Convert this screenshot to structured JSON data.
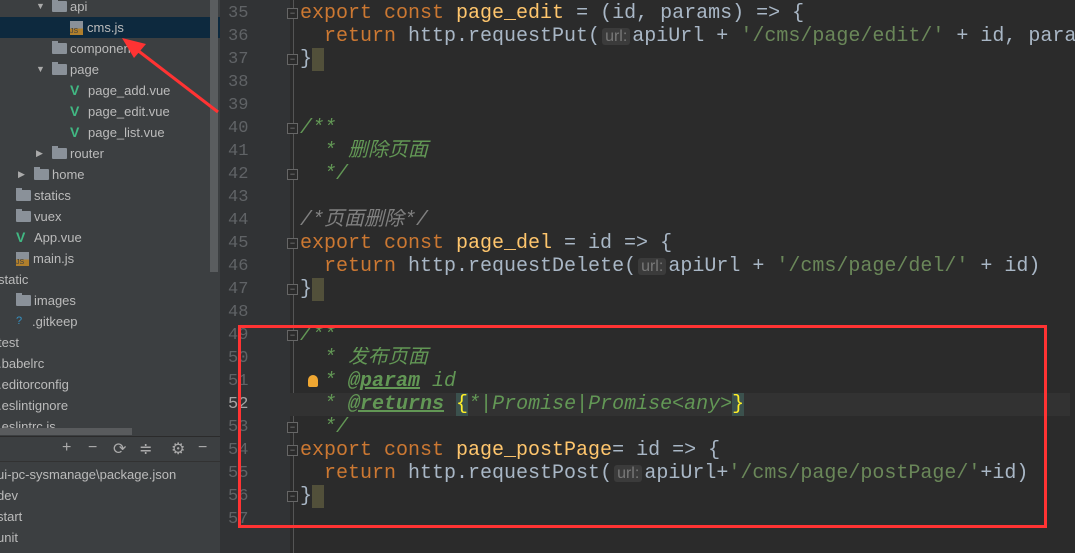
{
  "project_tree": [
    {
      "label": "api",
      "type": "folder",
      "indent": 1,
      "expanded": true
    },
    {
      "label": "cms.js",
      "type": "js",
      "indent": 2,
      "selected": true
    },
    {
      "label": "components",
      "type": "folder",
      "indent": 1
    },
    {
      "label": "page",
      "type": "folder",
      "indent": 1,
      "expanded": true
    },
    {
      "label": "page_add.vue",
      "type": "vue",
      "indent": 2
    },
    {
      "label": "page_edit.vue",
      "type": "vue",
      "indent": 2
    },
    {
      "label": "page_list.vue",
      "type": "vue",
      "indent": 2
    },
    {
      "label": "router",
      "type": "folder",
      "indent": 1,
      "collapsed": true
    },
    {
      "label": "home",
      "type": "folder",
      "indent": 0,
      "collapsed": true
    },
    {
      "label": "statics",
      "type": "folder",
      "indent": -1
    },
    {
      "label": "vuex",
      "type": "folder",
      "indent": -1
    },
    {
      "label": "App.vue",
      "type": "vue",
      "indent": -1
    },
    {
      "label": "main.js",
      "type": "js",
      "indent": -1
    },
    {
      "label": "static",
      "type": "text",
      "indent": -2
    },
    {
      "label": "images",
      "type": "folder",
      "indent": -1
    },
    {
      "label": ".gitkeep",
      "type": "file",
      "indent": -1
    },
    {
      "label": "test",
      "type": "text",
      "indent": -2
    },
    {
      "label": ".babelrc",
      "type": "text",
      "indent": -2
    },
    {
      "label": ".editorconfig",
      "type": "text",
      "indent": -2
    },
    {
      "label": ".eslintignore",
      "type": "text",
      "indent": -2
    },
    {
      "label": ".eslintrc.js",
      "type": "text",
      "indent": -2
    }
  ],
  "npm_panel": {
    "toolbar_icons": [
      "add-icon",
      "remove-icon",
      "refresh-icon",
      "collapse-all-icon",
      "gear-icon",
      "minimize-icon"
    ],
    "items": [
      "ui-pc-sysmanage\\package.json",
      "dev",
      "start",
      "unit"
    ]
  },
  "editor": {
    "current_line": 52,
    "lines": [
      {
        "n": "35",
        "fold": true,
        "t": [
          [
            "export const ",
            "kw"
          ],
          [
            "page_edit",
            "fn"
          ],
          [
            " = (id, params) => {",
            ""
          ]
        ]
      },
      {
        "n": "36",
        "t": [
          [
            "  return ",
            "kw"
          ],
          [
            "http.requestPut(",
            ""
          ],
          [
            "url:",
            "hint"
          ],
          [
            "apiUrl + ",
            ""
          ],
          [
            "'/cms/page/edit/'",
            "str"
          ],
          [
            " + id, params)",
            ""
          ]
        ]
      },
      {
        "n": "37",
        "fold": true,
        "t": [
          [
            "}",
            ""
          ],
          [
            " ",
            "caret"
          ]
        ]
      },
      {
        "n": "38",
        "t": []
      },
      {
        "n": "39",
        "t": []
      },
      {
        "n": "40",
        "fold": true,
        "t": [
          [
            "/**",
            "cm"
          ]
        ]
      },
      {
        "n": "41",
        "t": [
          [
            "  * 删除页面",
            "cm"
          ]
        ]
      },
      {
        "n": "42",
        "fold": true,
        "t": [
          [
            "  */",
            "cm"
          ]
        ]
      },
      {
        "n": "43",
        "t": []
      },
      {
        "n": "44",
        "t": [
          [
            "/*页面删除*/",
            "cmp"
          ]
        ]
      },
      {
        "n": "45",
        "fold": true,
        "t": [
          [
            "export const ",
            "kw"
          ],
          [
            "page_del",
            "fn"
          ],
          [
            " = id => {",
            ""
          ]
        ]
      },
      {
        "n": "46",
        "t": [
          [
            "  return ",
            "kw"
          ],
          [
            "http.requestDelete(",
            ""
          ],
          [
            "url:",
            "hint"
          ],
          [
            "apiUrl + ",
            ""
          ],
          [
            "'/cms/page/del/'",
            "str"
          ],
          [
            " + id)",
            ""
          ]
        ]
      },
      {
        "n": "47",
        "fold": true,
        "t": [
          [
            "}",
            ""
          ],
          [
            " ",
            "caret"
          ]
        ]
      },
      {
        "n": "48",
        "t": []
      },
      {
        "n": "49",
        "fold": true,
        "t": [
          [
            "/**",
            "cm"
          ]
        ]
      },
      {
        "n": "50",
        "t": [
          [
            "  * 发布页面",
            "cm"
          ]
        ]
      },
      {
        "n": "51",
        "bulb": true,
        "t": [
          [
            "  * ",
            "cm"
          ],
          [
            "@param",
            "tag"
          ],
          [
            " id",
            "cm"
          ]
        ]
      },
      {
        "n": "52",
        "t": [
          [
            "  * ",
            "cm"
          ],
          [
            "@returns",
            "tag"
          ],
          [
            " ",
            ""
          ],
          [
            "{",
            "brace"
          ],
          [
            "*|Promise|Promise<any>",
            "cm"
          ],
          [
            "}",
            "brace"
          ]
        ]
      },
      {
        "n": "53",
        "fold": true,
        "t": [
          [
            "  */",
            "cm"
          ]
        ]
      },
      {
        "n": "54",
        "fold": true,
        "t": [
          [
            "export const ",
            "kw"
          ],
          [
            "page_postPage",
            "fn"
          ],
          [
            "= id => {",
            ""
          ]
        ]
      },
      {
        "n": "55",
        "t": [
          [
            "  return ",
            "kw"
          ],
          [
            "http.requestPost(",
            ""
          ],
          [
            "url:",
            "hint"
          ],
          [
            "apiUrl+",
            ""
          ],
          [
            "'/cms/page/postPage/'",
            "str"
          ],
          [
            "+id)",
            ""
          ]
        ]
      },
      {
        "n": "56",
        "fold": true,
        "t": [
          [
            "}",
            ""
          ],
          [
            " ",
            "caret"
          ]
        ]
      },
      {
        "n": "57",
        "t": []
      }
    ]
  },
  "annotation_color": "#ff3333"
}
